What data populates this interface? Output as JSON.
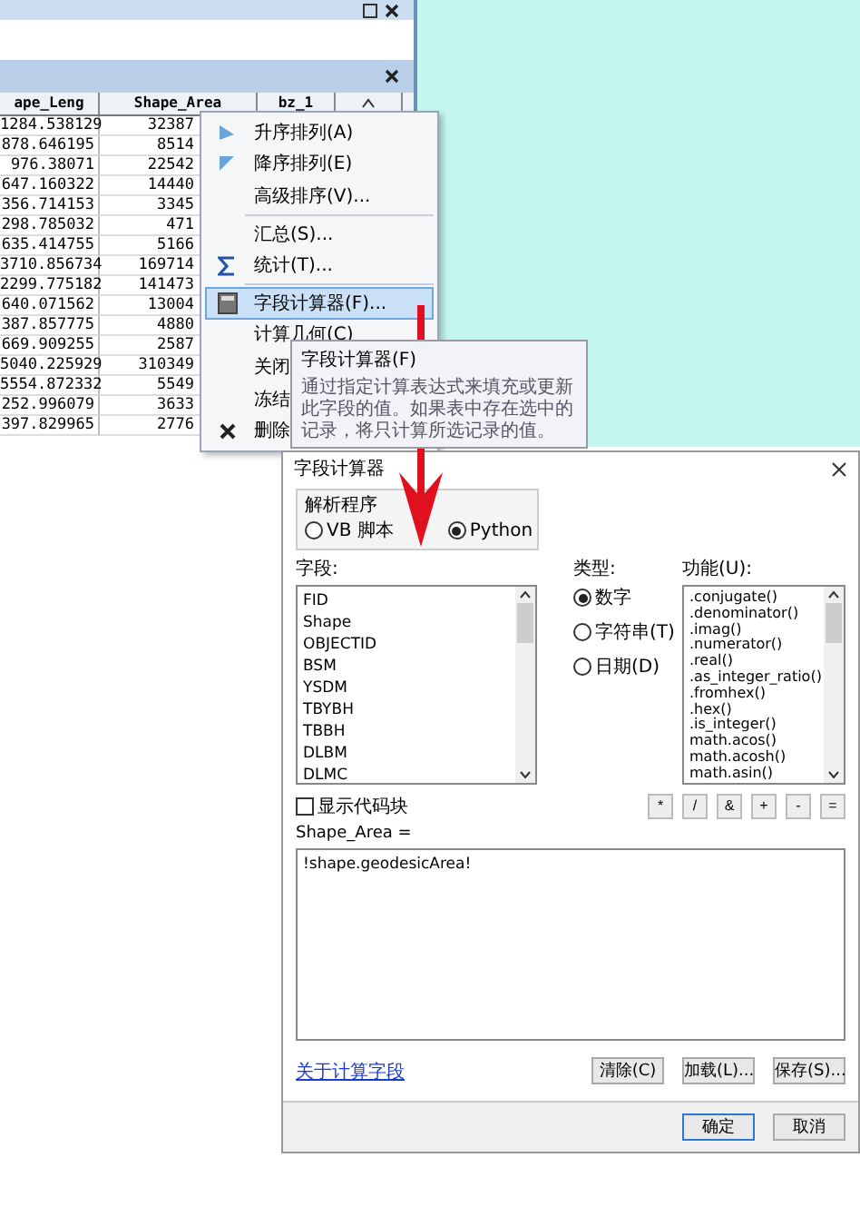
{
  "table_window": {
    "columns": [
      "ape_Leng",
      "Shape_Area",
      "bz_1"
    ],
    "rows": [
      [
        "1284.538129",
        "32387"
      ],
      [
        "878.646195",
        "8514"
      ],
      [
        "976.38071",
        "22542"
      ],
      [
        "647.160322",
        "14440"
      ],
      [
        "356.714153",
        "3345"
      ],
      [
        "298.785032",
        "471"
      ],
      [
        "635.414755",
        "5166"
      ],
      [
        "3710.856734",
        "169714"
      ],
      [
        "2299.775182",
        "141473"
      ],
      [
        "640.071562",
        "13004"
      ],
      [
        "387.857775",
        "4880"
      ],
      [
        "669.909255",
        "2587"
      ],
      [
        "5040.225929",
        "310349"
      ],
      [
        "5554.872332",
        "5549"
      ],
      [
        "252.996079",
        "3633"
      ],
      [
        "397.829965",
        "2776"
      ]
    ]
  },
  "context_menu": {
    "items": [
      {
        "label": "升序排列(A)",
        "selected": false
      },
      {
        "label": "降序排列(E)",
        "selected": false
      },
      {
        "label": "高级排序(V)...",
        "selected": false
      },
      {
        "label": "汇总(S)...",
        "selected": false
      },
      {
        "label": "统计(T)...",
        "selected": false
      },
      {
        "label": "字段计算器(F)...",
        "selected": true
      },
      {
        "label": "计算几何(C)",
        "selected": false
      },
      {
        "label": "关闭",
        "selected": false
      },
      {
        "label": "冻结",
        "selected": false
      },
      {
        "label": "删除",
        "selected": false
      }
    ]
  },
  "tooltip": {
    "title": "字段计算器(F)",
    "text": "通过指定计算表达式来填充或更新此字段的值。如果表中存在选中的记录，将只计算所选记录的值。"
  },
  "dialog": {
    "title": "字段计算器",
    "parser": {
      "label": "解析程序",
      "options": [
        {
          "label": "VB 脚本",
          "selected": false
        },
        {
          "label": "Python",
          "selected": true
        }
      ]
    },
    "fields": {
      "label": "字段:",
      "items": [
        "FID",
        "Shape",
        "OBJECTID",
        "BSM",
        "YSDM",
        "TBYBH",
        "TBBH",
        "DLBM",
        "DLMC"
      ]
    },
    "type": {
      "label": "类型:",
      "options": [
        {
          "label": "数字",
          "selected": true
        },
        {
          "label": "字符串(T)",
          "selected": false
        },
        {
          "label": "日期(D)",
          "selected": false
        }
      ]
    },
    "functions": {
      "label": "功能(U):",
      "items": [
        ".conjugate()",
        ".denominator()",
        ".imag()",
        ".numerator()",
        ".real()",
        ".as_integer_ratio()",
        ".fromhex()",
        ".hex()",
        ".is_integer()",
        "math.acos()",
        "math.acosh()",
        "math.asin()"
      ]
    },
    "show_codeblock": {
      "label": "显示代码块",
      "checked": false
    },
    "operators": [
      "*",
      "/",
      "&",
      "+",
      "-",
      "="
    ],
    "expression_label": "Shape_Area =",
    "expression": "!shape.geodesicArea!",
    "help_link": "关于计算字段",
    "buttons": [
      "清除(C)",
      "加载(L)...",
      "保存(S)..."
    ],
    "footer_buttons": [
      {
        "label": "确定",
        "default": true
      },
      {
        "label": "取消",
        "default": false
      }
    ]
  }
}
